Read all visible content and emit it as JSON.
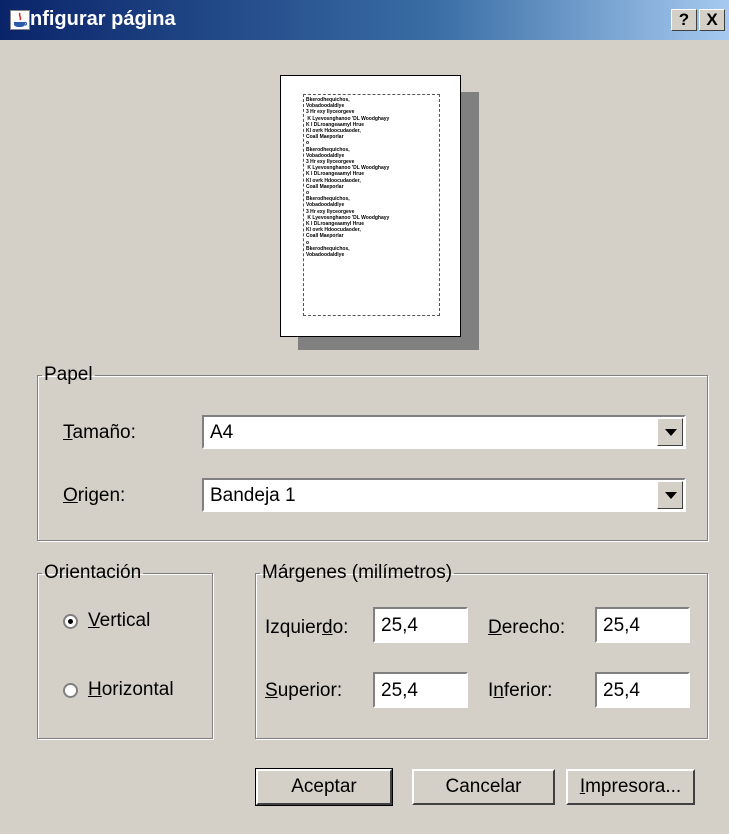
{
  "window": {
    "title": "nfigurar página",
    "help_label": "?",
    "close_label": "X"
  },
  "preview": {
    "lines": [
      "Bkerodhequichos,",
      "Vobadoodaldlye",
      "3 Hr exy Ilyceorgeve",
      " K Lyevosnghanoo 'DL Woodghayy",
      "K I DLroangeaamyl Hrue",
      "Kl ovrk Hdoocudaoder,",
      "Coall Maeporlar",
      "o",
      "Bkerodhequichos,",
      "Vobadoodaldlye",
      "3 Hr exy Ilyceorgeve",
      " K Lyevosnghanoo 'DL Woodghayy",
      "K I DLroangeaamyl Hrue",
      "Kl ovrk Hdoocudaoder,",
      "Coall Maeporlar",
      "o",
      "Bkerodhequichos,",
      "Vobadoodaldlye",
      "3 Hr exy Ilyceorgeve",
      " K Lyevosnghanoo 'DL Woodghayy",
      "K I DLroangeaamyl Hrue",
      "Kl ovrk Hdoocudaoder,",
      "Coall Maeporlar",
      "o",
      "Bkerodhequichos,",
      "Vobadoodaldlye"
    ]
  },
  "paper": {
    "legend": "Papel",
    "size_label_mnemonic": "T",
    "size_label_rest": "amaño:",
    "size_value": "A4",
    "source_label_mnemonic": "O",
    "source_label_rest": "rigen:",
    "source_value": "Bandeja 1"
  },
  "orientation": {
    "legend": "Orientación",
    "portrait_mnemonic": "V",
    "portrait_rest": "ertical",
    "landscape_mnemonic": "H",
    "landscape_rest": "orizontal",
    "selected": "portrait"
  },
  "margins": {
    "legend": "Márgenes (milímetros)",
    "left_pre": "Izquier",
    "left_mnemonic": "d",
    "left_post": "o:",
    "left_value": "25,4",
    "right_mnemonic": "D",
    "right_rest": "erecho:",
    "right_value": "25,4",
    "top_mnemonic": "S",
    "top_rest": "uperior:",
    "top_value": "25,4",
    "bottom_pre": "I",
    "bottom_mnemonic": "n",
    "bottom_post": "ferior:",
    "bottom_value": "25,4"
  },
  "buttons": {
    "ok_label": "Aceptar",
    "cancel_label": "Cancelar",
    "printer_mnemonic": "I",
    "printer_rest": "mpresora..."
  }
}
